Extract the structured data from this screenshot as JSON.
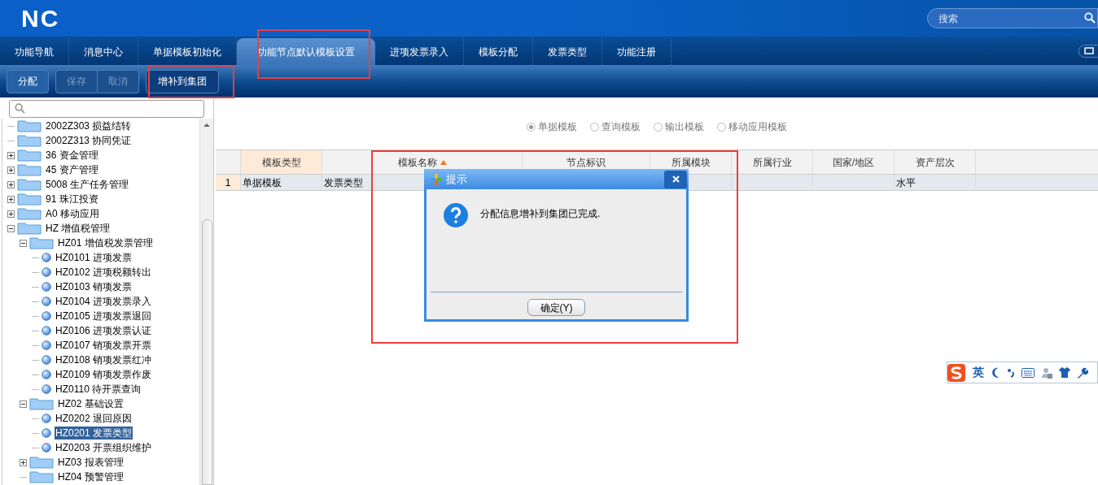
{
  "header": {
    "logo": "NC",
    "search": {
      "placeholder": "搜索"
    }
  },
  "tabs": [
    {
      "label": "功能导航",
      "selected": false
    },
    {
      "label": "消息中心",
      "selected": false
    },
    {
      "label": "单据模板初始化",
      "selected": false
    },
    {
      "label": "功能节点默认模板设置",
      "selected": true
    },
    {
      "label": "进项发票录入",
      "selected": false
    },
    {
      "label": "模板分配",
      "selected": false
    },
    {
      "label": "发票类型",
      "selected": false
    },
    {
      "label": "功能注册",
      "selected": false
    }
  ],
  "toolbar": {
    "groups": [
      {
        "buttons": [
          {
            "label": "分配",
            "disabled": false
          }
        ]
      },
      {
        "buttons": [
          {
            "label": "保存",
            "disabled": true
          },
          {
            "label": "取消",
            "disabled": true
          }
        ]
      },
      {
        "buttons": [
          {
            "label": "增补到集团",
            "disabled": false
          }
        ]
      }
    ]
  },
  "tree": {
    "items": [
      {
        "label": "2002Z303 损益结转",
        "kind": "folder",
        "selected": false
      },
      {
        "label": "2002Z313 协同凭证",
        "kind": "folder",
        "selected": false
      },
      {
        "label": "36 资金管理",
        "kind": "folder",
        "expanded": false,
        "selected": false
      },
      {
        "label": "45 资产管理",
        "kind": "folder",
        "expanded": false,
        "selected": false
      },
      {
        "label": "5008 生产任务管理",
        "kind": "folder",
        "expanded": false,
        "selected": false
      },
      {
        "label": "91 珠江投资",
        "kind": "folder",
        "expanded": false,
        "selected": false
      },
      {
        "label": "A0 移动应用",
        "kind": "folder",
        "expanded": false,
        "selected": false
      },
      {
        "label": "HZ 增值税管理",
        "kind": "folder",
        "expanded": true,
        "selected": false,
        "children": [
          {
            "label": "HZ01 增值税发票管理",
            "kind": "folder",
            "expanded": true,
            "selected": false,
            "children": [
              {
                "label": "HZ0101 进项发票",
                "kind": "leaf",
                "selected": false
              },
              {
                "label": "HZ0102 进项税额转出",
                "kind": "leaf",
                "selected": false
              },
              {
                "label": "HZ0103 销项发票",
                "kind": "leaf",
                "selected": false
              },
              {
                "label": "HZ0104 进项发票录入",
                "kind": "leaf",
                "selected": false
              },
              {
                "label": "HZ0105 进项发票退回",
                "kind": "leaf",
                "selected": false
              },
              {
                "label": "HZ0106 进项发票认证",
                "kind": "leaf",
                "selected": false
              },
              {
                "label": "HZ0107 销项发票开票",
                "kind": "leaf",
                "selected": false
              },
              {
                "label": "HZ0108 销项发票红冲",
                "kind": "leaf",
                "selected": false
              },
              {
                "label": "HZ0109 销项发票作废",
                "kind": "leaf",
                "selected": false
              },
              {
                "label": "HZ0110 待开票查询",
                "kind": "leaf",
                "selected": false
              }
            ]
          },
          {
            "label": "HZ02 基础设置",
            "kind": "folder",
            "expanded": true,
            "selected": false,
            "children": [
              {
                "label": "HZ0202 退回原因",
                "kind": "leaf",
                "selected": false
              },
              {
                "label": "HZ0201 发票类型",
                "kind": "leaf",
                "selected": true
              },
              {
                "label": "HZ0203 开票组织维护",
                "kind": "leaf",
                "selected": false
              }
            ]
          },
          {
            "label": "HZ03 报表管理",
            "kind": "folder",
            "expanded": false,
            "selected": false
          },
          {
            "label": "HZ04 预警管理",
            "kind": "folder",
            "selected": false
          }
        ]
      }
    ]
  },
  "template_types": [
    {
      "label": "单据模板",
      "selected": true
    },
    {
      "label": "查询模板",
      "selected": false
    },
    {
      "label": "输出模板",
      "selected": false
    },
    {
      "label": "移动应用模板",
      "selected": false
    }
  ],
  "table": {
    "columns": [
      {
        "label": "模板类型",
        "highlighted": true
      },
      {
        "label": "模板名称",
        "highlighted": false,
        "sorted": true
      },
      {
        "label": "节点标识",
        "highlighted": false
      },
      {
        "label": "所属模块",
        "highlighted": false
      },
      {
        "label": "所属行业",
        "highlighted": false
      },
      {
        "label": "国家/地区",
        "highlighted": false
      },
      {
        "label": "资产层次",
        "highlighted": false
      }
    ],
    "rows": [
      {
        "number": "1",
        "selected": true,
        "cells": [
          {
            "text": "单据模板"
          },
          {
            "text": "发票类型"
          },
          {},
          {},
          {},
          {},
          {
            "text": "水平"
          }
        ]
      }
    ]
  },
  "dialog": {
    "title": "提示",
    "message": "分配信息增补到集团已完成.",
    "button": "确定(Y)"
  },
  "ime_bar": {
    "mode": "英"
  }
}
